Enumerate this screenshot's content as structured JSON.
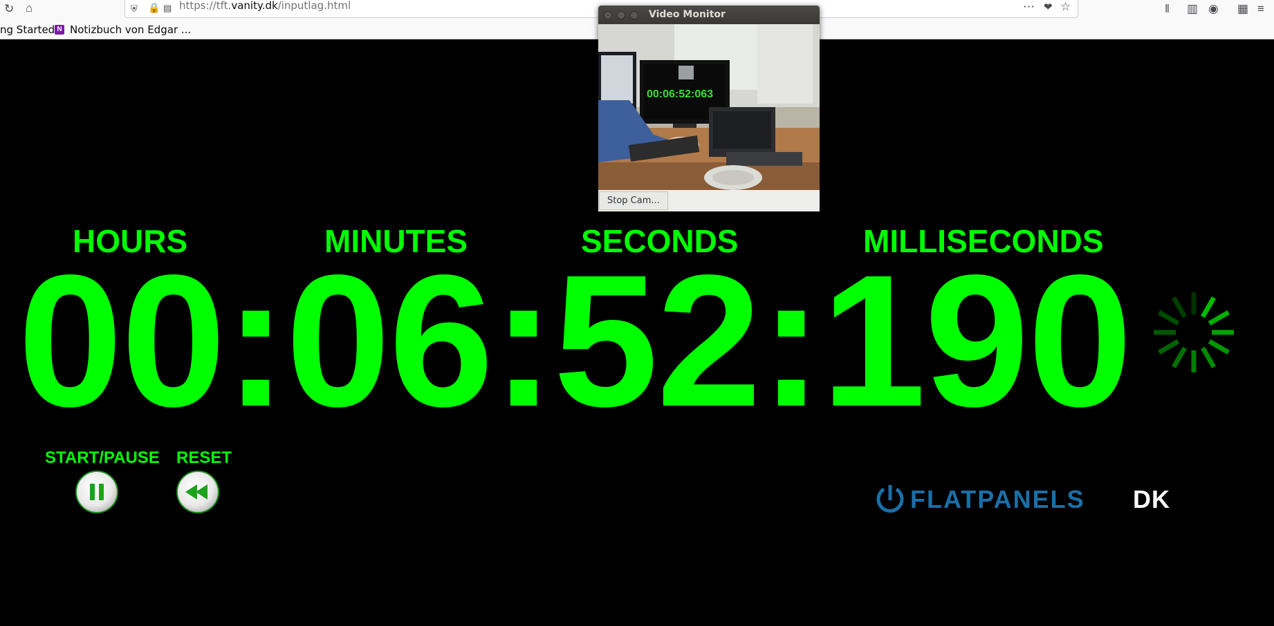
{
  "browser": {
    "url_prefix": "https://tft.",
    "url_host": "vanity.dk",
    "url_path": "/inputlag.html",
    "bookmarks": [
      {
        "label": "ng Started"
      },
      {
        "label": "Notizbuch von Edgar ...",
        "icon_text": "N"
      }
    ]
  },
  "timer": {
    "labels": {
      "hours": "HOURS",
      "minutes": "MINUTES",
      "seconds": "SECONDS",
      "milliseconds": "MILLISECONDS"
    },
    "display": "00:06:52:190",
    "color": "#00ff00"
  },
  "controls": {
    "start_pause_label": "START/PAUSE",
    "reset_label": "RESET",
    "start_pause_icon": "pause-icon",
    "reset_icon": "rewind-icon"
  },
  "logo": {
    "text_primary": "FLATPANELS",
    "text_secondary": "DK",
    "primary_color": "#1a6fa8",
    "secondary_color": "#ffffff"
  },
  "video_monitor": {
    "title": "Video Monitor",
    "stop_button": "Stop Cam...",
    "video_timer_text": "00:06:52:063"
  }
}
